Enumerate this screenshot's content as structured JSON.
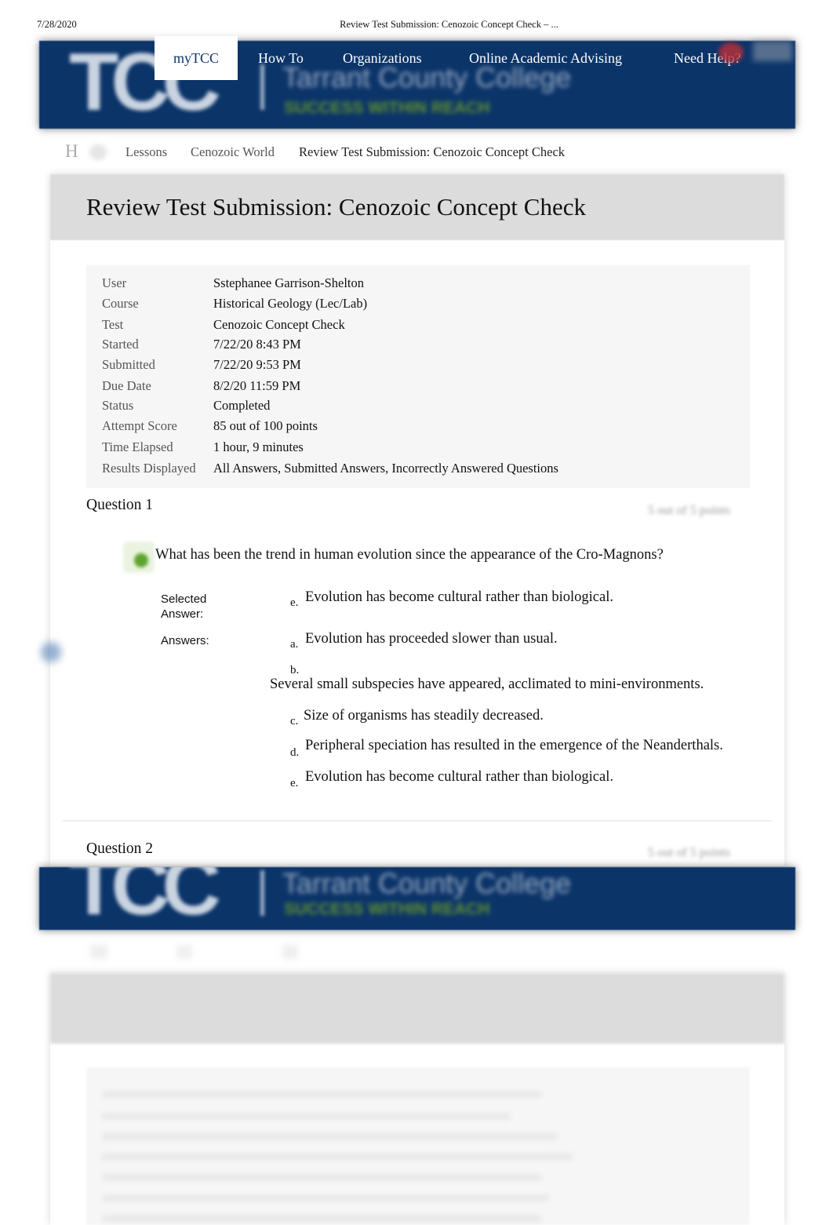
{
  "print_header": {
    "date": "7/28/2020",
    "title": "Review Test Submission: Cenozoic Concept Check – ..."
  },
  "banner": {
    "logo_text": "TCC",
    "college_name": "Tarrant County College",
    "tagline": "SUCCESS WITHIN REACH"
  },
  "nav": {
    "items": [
      {
        "label": "myTCC",
        "active": true
      },
      {
        "label": "How To"
      },
      {
        "label": "Organizations"
      },
      {
        "label": "Online Academic Advising"
      },
      {
        "label": "Need Help?"
      }
    ]
  },
  "breadcrumb": {
    "home_icon": "H",
    "items": [
      "Lessons",
      "Cenozoic World",
      "Review Test Submission: Cenozoic Concept Check"
    ]
  },
  "page": {
    "title": "Review Test Submission: Cenozoic Concept Check"
  },
  "submission_info": [
    {
      "label": "User",
      "value": "Sstephanee Garrison-Shelton"
    },
    {
      "label": "Course",
      "value": "Historical Geology (Lec/Lab)"
    },
    {
      "label": "Test",
      "value": "Cenozoic Concept Check"
    },
    {
      "label": "Started",
      "value": "7/22/20 8:43 PM"
    },
    {
      "label": "Submitted",
      "value": "7/22/20 9:53 PM"
    },
    {
      "label": "Due Date",
      "value": "8/2/20 11:59 PM"
    },
    {
      "label": "Status",
      "value": "Completed"
    },
    {
      "label": "Attempt Score",
      "value": "85 out of 100 points"
    },
    {
      "label": "Time Elapsed",
      "value": "1 hour, 9 minutes"
    },
    {
      "label": "Results Displayed",
      "value": "All Answers, Submitted Answers, Incorrectly Answered Questions"
    }
  ],
  "questions": [
    {
      "heading": "Question 1",
      "points": "5 out of 5 points",
      "status": "correct",
      "text": "What has been the trend in human evolution since the appearance of the Cro-Magnons?",
      "selected_label": "Selected Answer:",
      "selected_letter": "e.",
      "selected_answer": "Evolution has become cultural rather than biological.",
      "answers_label": "Answers:",
      "answers": [
        {
          "letter": "a.",
          "text": "Evolution has proceeded slower than usual."
        },
        {
          "letter": "b.",
          "text": "Several small subspecies have appeared, acclimated to mini-environments."
        },
        {
          "letter": "c.",
          "text": "Size of organisms has steadily decreased."
        },
        {
          "letter": "d.",
          "text": "Peripheral speciation has resulted in the emergence of the Neanderthals."
        },
        {
          "letter": "e.",
          "text": "Evolution has become cultural rather than biological."
        }
      ]
    },
    {
      "heading": "Question 2",
      "points": "5 out of 5 points"
    }
  ]
}
